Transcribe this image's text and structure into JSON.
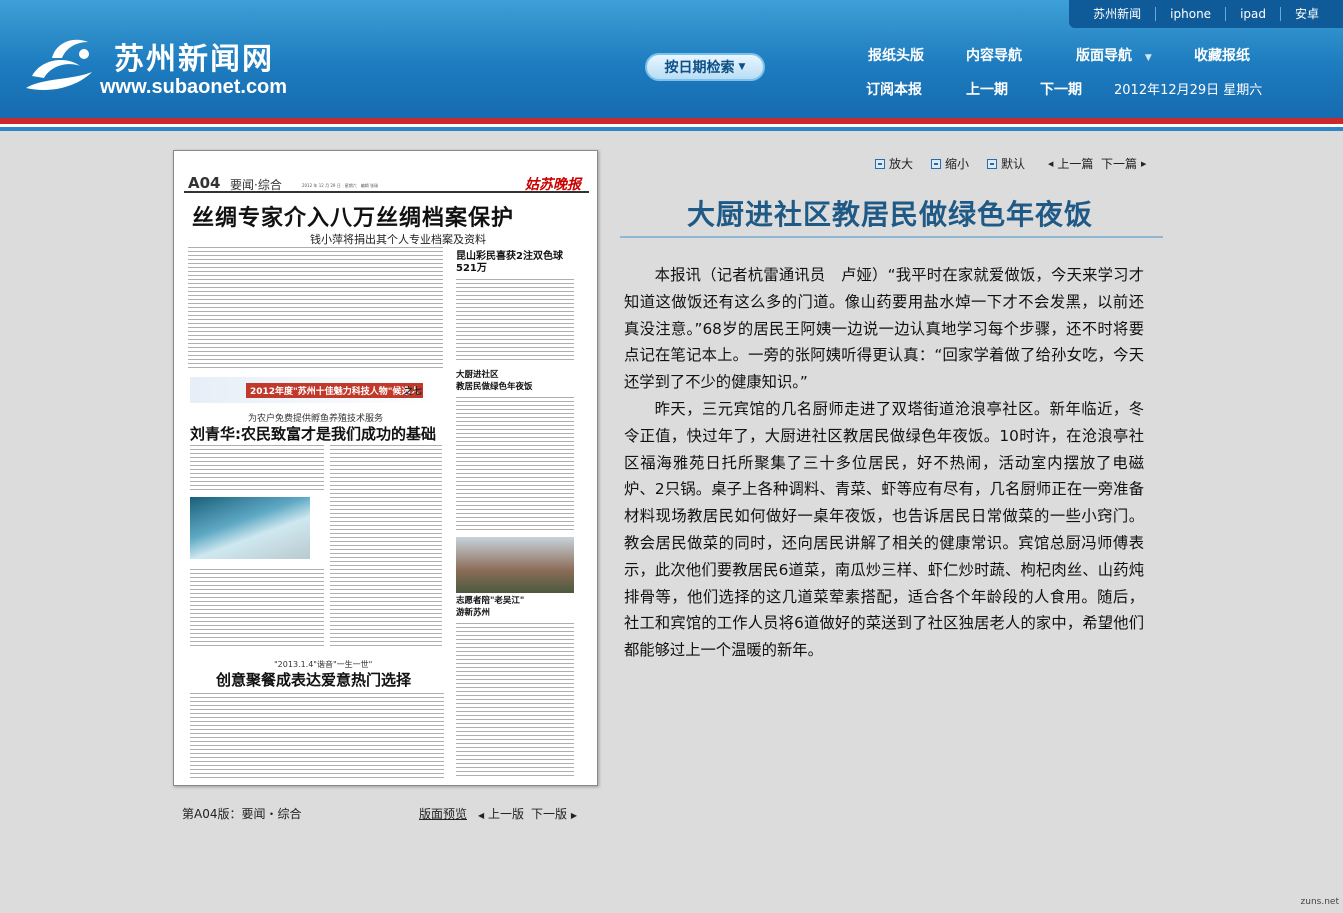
{
  "top_links": [
    "苏州新闻",
    "iphone",
    "ipad",
    "安卓"
  ],
  "logo": {
    "cn": "苏州新闻网",
    "en": "www.subaonet.com"
  },
  "date_search": {
    "label": "按日期检索"
  },
  "nav": {
    "row1": [
      "报纸头版",
      "内容导航",
      "版面导航",
      "收藏报纸"
    ],
    "row2": [
      "订阅本报",
      "上一期",
      "下一期"
    ],
    "date": "2012年12月29日 星期六"
  },
  "paper": {
    "page": "A04",
    "section": "要闻·综合",
    "date_line": "2012 年 12 月 29 日　星期六　编辑 张瑞",
    "brand": "姑苏晚报",
    "headline": "丝绸专家介入八万丝绸档案保护",
    "subhead": "钱小萍将捐出其个人专业档案及资料",
    "right_head": "昆山彩民喜获2注双色球 521万",
    "right_head2": "大厨进社区\n教居民做绿色年夜饭",
    "right_head3": "志愿者陪\"老吴江\"\n游新苏州",
    "banner": "2012年度\"苏州十佳魅力科技人物\"候选人",
    "banner_suffix": "之七",
    "h2_pre": "为农户免费提供孵鱼养殖技术服务",
    "h2": "刘青华:农民致富才是我们成功的基础",
    "h3_pre": "\"2013.1.4\"谐音\"一生一世\"",
    "h3": "创意聚餐成表达爱意热门选择"
  },
  "paper_footer": {
    "caption": "第A04版：要闻・综合",
    "preview": "版面预览",
    "prev": "上一版",
    "next": "下一版"
  },
  "tools": {
    "zoom_in": "放大",
    "zoom_out": "缩小",
    "default": "默认",
    "prev": "上一篇",
    "next": "下一篇"
  },
  "article": {
    "title": "大厨进社区教居民做绿色年夜饭",
    "paragraphs": [
      "本报讯（记者杭雷通讯员　卢娅）“我平时在家就爱做饭，今天来学习才知道这做饭还有这么多的门道。像山药要用盐水焯一下才不会发黑，以前还真没注意。”68岁的居民王阿姨一边说一边认真地学习每个步骤，还不时将要点记在笔记本上。一旁的张阿姨听得更认真：“回家学着做了给孙女吃，今天还学到了不少的健康知识。”",
      "昨天，三元宾馆的几名厨师走进了双塔街道沧浪亭社区。新年临近，冬令正值，快过年了，大厨进社区教居民做绿色年夜饭。10时许，在沧浪亭社区福海雅苑日托所聚集了三十多位居民，好不热闹，活动室内摆放了电磁炉、2只锅。桌子上各种调料、青菜、虾等应有尽有，几名厨师正在一旁准备材料现场教居民如何做好一桌年夜饭，也告诉居民日常做菜的一些小窍门。教会居民做菜的同时，还向居民讲解了相关的健康常识。宾馆总厨冯师傅表示，此次他们要教居民6道菜，南瓜炒三样、虾仁炒时蔬、枸杞肉丝、山药炖排骨等，他们选择的这几道菜荤素搭配，适合各个年龄段的人食用。随后，社工和宾馆的工作人员将6道做好的菜送到了社区独居老人的家中，希望他们都能够过上一个温暖的新年。"
    ]
  },
  "watermark": "zuns.net",
  "colors": {
    "header": "#1d7cbf",
    "stripe_red": "#c9282d",
    "title_blue": "#1f5a86"
  }
}
